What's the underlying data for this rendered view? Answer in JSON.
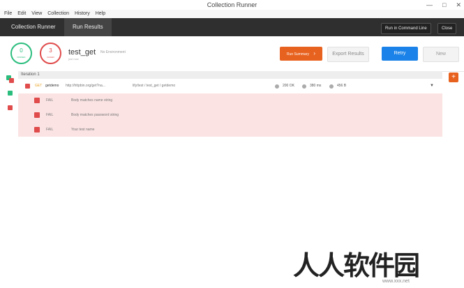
{
  "window": {
    "title": "Collection Runner"
  },
  "menu": [
    "File",
    "Edit",
    "View",
    "Collection",
    "History",
    "Help"
  ],
  "tabs": [
    {
      "label": "Collection Runner"
    },
    {
      "label": "Run Results"
    }
  ],
  "toolbar": {
    "run_cmd_label": "Run in Command Line",
    "close_label": "Close"
  },
  "summary": {
    "passed_count": "0",
    "passed_label": "PASSED",
    "failed_count": "3",
    "failed_label": "FAILED",
    "run_name": "test_get",
    "environment": "No Environment",
    "run_subtitle": "just now"
  },
  "actions": {
    "run_summary": "Run Summary",
    "export": "Export Results",
    "retry": "Retry",
    "new": "New"
  },
  "iteration": {
    "label": "Iteration 1"
  },
  "request": {
    "method": "GET",
    "name": "getdemo",
    "url": "http://httpbin.org/get?na...",
    "path": "lify/test / test_get / getdemo",
    "status": "200 OK",
    "time": "380 ms",
    "size": "456 B"
  },
  "tests": [
    {
      "result": "FAIL",
      "name": "Body matches name string"
    },
    {
      "result": "FAIL",
      "name": "Body matches password string"
    },
    {
      "result": "FAIL",
      "name": "Your test name"
    }
  ],
  "colors": {
    "accent": "#e8621f",
    "fail": "#e04b4b",
    "pass": "#2bbd7e",
    "primary": "#1a82e8"
  },
  "watermark": {
    "text": "人人软件园",
    "url": "www.xxx.net"
  }
}
